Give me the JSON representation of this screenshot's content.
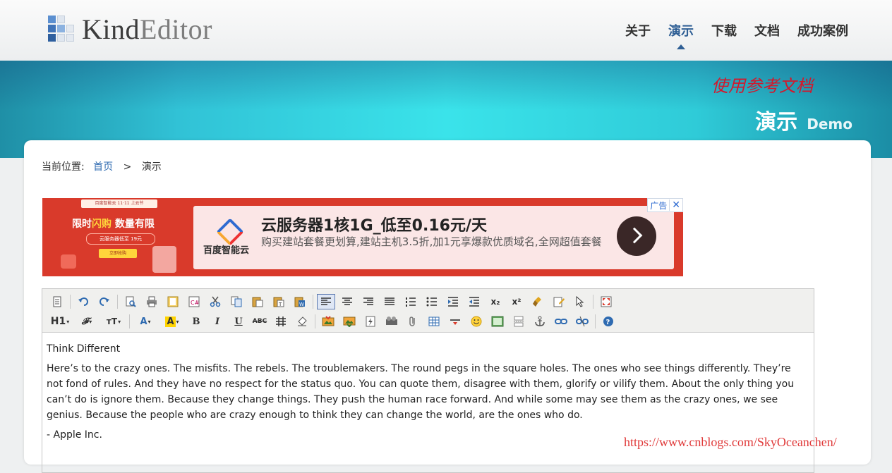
{
  "header": {
    "logo_kind": "Kind",
    "logo_editor": "Editor",
    "nav": [
      {
        "label": "关于",
        "active": false
      },
      {
        "label": "演示",
        "active": true
      },
      {
        "label": "下载",
        "active": false
      },
      {
        "label": "文档",
        "active": false
      },
      {
        "label": "成功案例",
        "active": false
      }
    ]
  },
  "banner": {
    "reference_link": "使用参考文档",
    "title_zh": "演示",
    "title_en": "Demo"
  },
  "breadcrumb": {
    "prefix": "当前位置:",
    "home": "首页",
    "separator": ">",
    "current": "演示"
  },
  "ad": {
    "mini_bar": "百度智能云 11·11 上云节",
    "flash_pre": "限时",
    "flash_hl": "闪购",
    "flash_post": "数量有限",
    "price_line": "云服务器低至 19元",
    "button": "立即抢购",
    "brand": "百度智能云",
    "headline": "云服务器1核1G_低至0.16元/天",
    "description": "购买建站套餐更划算,建站主机3.5折,加1元享爆款优质域名,全网超值套餐",
    "tag": "广告",
    "close": "✕"
  },
  "toolbar": {
    "row1": [
      "source",
      "undo",
      "redo",
      "preview",
      "print",
      "template",
      "code",
      "cut",
      "copy",
      "paste",
      "plainpaste",
      "wordpaste",
      "justifyleft",
      "justifycenter",
      "justifyright",
      "justifyfull",
      "insertorderedlist",
      "insertunorderedlist",
      "indent",
      "outdent",
      "subscript",
      "superscript",
      "clearhtml",
      "quickformat",
      "selectall",
      "fullscreen"
    ],
    "row2": [
      "formatblock",
      "fontname",
      "fontsize",
      "forecolor",
      "hilitecolor",
      "bold",
      "italic",
      "underline",
      "strikethrough",
      "lineheight",
      "removeformat",
      "image",
      "multiimage",
      "flash",
      "media",
      "insertfile",
      "table",
      "hr",
      "emoticons",
      "baidumap",
      "pagebreak",
      "anchor",
      "link",
      "unlink",
      "about"
    ],
    "labels": {
      "heading": "H1",
      "subscript": "x₂",
      "superscript": "x²",
      "bold": "B",
      "italic": "I",
      "underline": "U",
      "strike": "ABC"
    }
  },
  "content": {
    "title": "Think Different",
    "body": "Here’s to the crazy ones. The misfits. The rebels. The troublemakers. The round pegs in the square holes. The ones who see things differently. They’re not fond of rules. And they have no respect for the status quo. You can quote them, disagree with them, glorify or vilify them. About the only thing you can’t do is ignore them. Because they change things. They push the human race forward. And while some may see them as the crazy ones, we see genius. Because the people who are crazy enough to think they can change the world, are the ones who do.",
    "signature": "- Apple Inc."
  },
  "watermark": "https://www.cnblogs.com/SkyOceanchen/",
  "colors": {
    "nav_active": "#2f5f95",
    "banner_accent": "#3ae3ea",
    "reference_link": "#d4172b",
    "ad_red": "#d93a2b",
    "watermark": "#e03a3a"
  }
}
